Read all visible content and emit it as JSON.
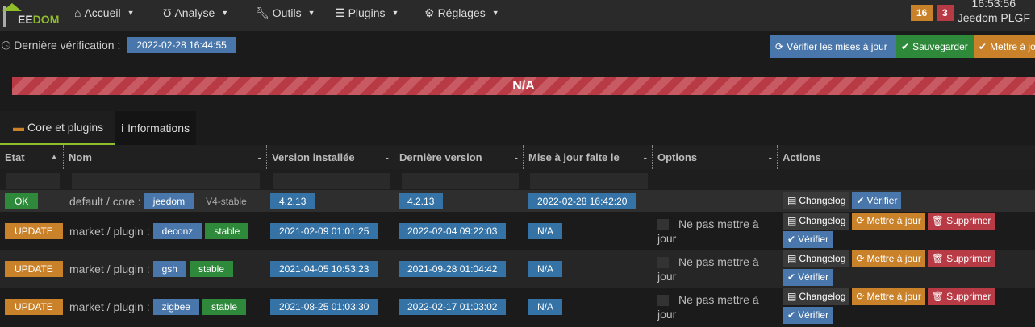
{
  "navbar": {
    "logo": "JEEDOM",
    "menus": [
      {
        "label": "Accueil",
        "icon": "home-icon"
      },
      {
        "label": "Analyse",
        "icon": "stethoscope-icon"
      },
      {
        "label": "Outils",
        "icon": "wrench-icon"
      },
      {
        "label": "Plugins",
        "icon": "tasks-icon"
      },
      {
        "label": "Réglages",
        "icon": "cog-icon"
      }
    ],
    "badge_orange": "16",
    "badge_red": "3",
    "clock": "16:53:56",
    "user": "Jeedom PLGF"
  },
  "lastcheck": {
    "label": "Dernière vérification :",
    "value": "2022-02-28 16:44:55"
  },
  "toolbar": {
    "check": "Vérifier les mises à jour",
    "save": "Sauvegarder",
    "update": "Mettre à jour"
  },
  "progress": {
    "text": "N/A",
    "value": null
  },
  "tabs": [
    {
      "label": "Core et plugins"
    },
    {
      "label": "Informations"
    }
  ],
  "table": {
    "headers": [
      "Etat",
      "Nom",
      "Version installée",
      "Dernière version",
      "Mise à jour faite le",
      "Options",
      "Actions"
    ],
    "sort_mark": "▲",
    "nosort": "-",
    "option_label": "Ne pas mettre à jour",
    "actions": {
      "changelog": "Changelog",
      "update": "Mettre à jour",
      "delete": "Supprimer",
      "verify": "Vérifier"
    },
    "rows": [
      {
        "status": "OK",
        "source": "default / core :",
        "name": "jeedom",
        "branch": "V4-stable",
        "installed": "4.2.13",
        "latest": "4.2.13",
        "updated": "2022-02-28 16:42:20"
      },
      {
        "status": "UPDATE",
        "source": "market / plugin :",
        "name": "deconz",
        "branch": "stable",
        "installed": "2021-02-09 01:01:25",
        "latest": "2022-02-04 09:22:03",
        "updated": "N/A"
      },
      {
        "status": "UPDATE",
        "source": "market / plugin :",
        "name": "gsh",
        "branch": "stable",
        "installed": "2021-04-05 10:53:23",
        "latest": "2021-09-28 01:04:42",
        "updated": "N/A"
      },
      {
        "status": "UPDATE",
        "source": "market / plugin :",
        "name": "zigbee",
        "branch": "stable",
        "installed": "2021-08-25 01:03:30",
        "latest": "2022-02-17 01:03:02",
        "updated": "N/A"
      }
    ]
  }
}
